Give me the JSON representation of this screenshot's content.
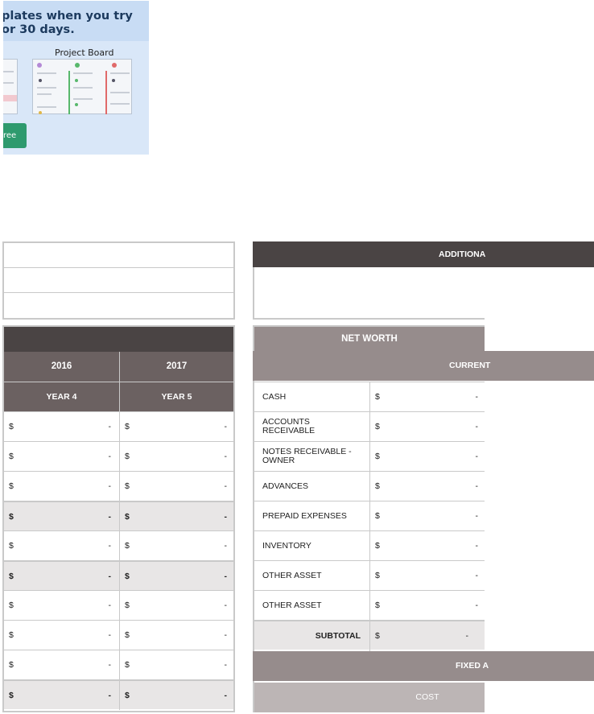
{
  "ad": {
    "headline_line1": "plates when you try",
    "headline_line2": "or 30 days.",
    "board_title": "Project Board",
    "button_label": "ree"
  },
  "additional": {
    "header_label": "ADDITIONA"
  },
  "left_table": {
    "years": [
      "2016",
      "2017"
    ],
    "year_labels": [
      "YEAR 4",
      "YEAR 5"
    ],
    "currency": "$",
    "dash": "-",
    "rows": [
      {
        "type": "normal"
      },
      {
        "type": "normal"
      },
      {
        "type": "normal"
      },
      {
        "type": "subtotal"
      },
      {
        "type": "normal"
      },
      {
        "type": "subtotal"
      },
      {
        "type": "normal"
      },
      {
        "type": "normal"
      },
      {
        "type": "normal"
      },
      {
        "type": "subtotal"
      }
    ]
  },
  "net_worth": {
    "title": "NET WORTH",
    "current_band": "CURRENT",
    "currency": "$",
    "dash": "-",
    "items": [
      {
        "label": "CASH"
      },
      {
        "label": "ACCOUNTS RECEIVABLE"
      },
      {
        "label": "NOTES RECEIVABLE - OWNER"
      },
      {
        "label": "ADVANCES"
      },
      {
        "label": "PREPAID EXPENSES"
      },
      {
        "label": "INVENTORY"
      },
      {
        "label": "OTHER ASSET"
      },
      {
        "label": "OTHER ASSET"
      }
    ],
    "subtotal_label": "SUBTOTAL",
    "fixed_band": "FIXED A",
    "cost_label": "COST"
  },
  "colors": {
    "dark_header": "#4a4444",
    "mid_header": "#6b6161",
    "light_header": "#968c8c",
    "subtotal_bg": "#e8e6e6",
    "ad_bg": "#d9e7f8",
    "ad_button": "#2e9a6e"
  }
}
